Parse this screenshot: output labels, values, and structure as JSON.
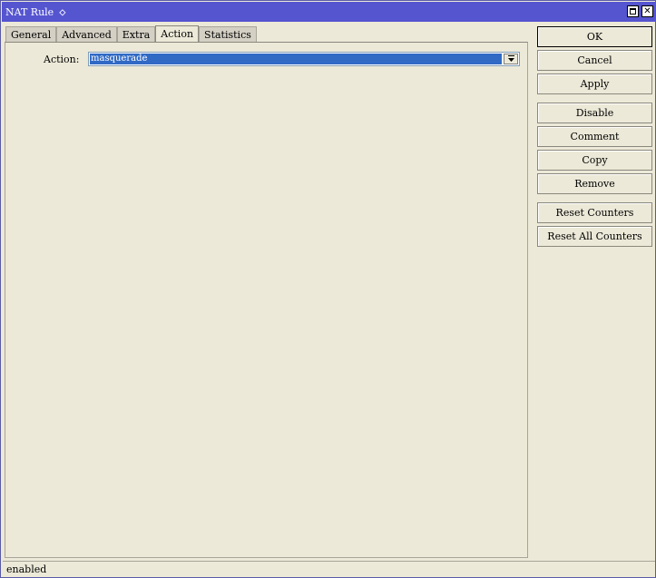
{
  "window": {
    "title": "NAT Rule",
    "title_symbol": "◇"
  },
  "tabs": [
    {
      "label": "General"
    },
    {
      "label": "Advanced"
    },
    {
      "label": "Extra"
    },
    {
      "label": "Action",
      "active": true
    },
    {
      "label": "Statistics"
    }
  ],
  "action_field": {
    "label": "Action:",
    "value": "masquerade"
  },
  "buttons": {
    "ok": "OK",
    "cancel": "Cancel",
    "apply": "Apply",
    "disable": "Disable",
    "comment": "Comment",
    "copy": "Copy",
    "remove": "Remove",
    "reset_counters": "Reset Counters",
    "reset_all_counters": "Reset All Counters"
  },
  "status": {
    "text": "enabled"
  },
  "colors": {
    "titlebar": "#5555d0",
    "selection": "#316ac5",
    "background": "#ece9d8"
  }
}
